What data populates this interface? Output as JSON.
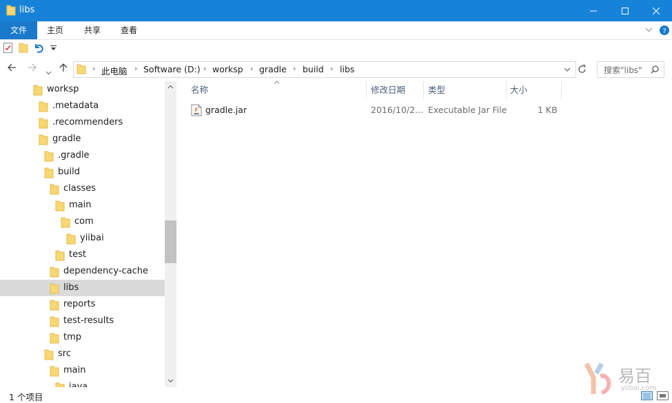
{
  "window": {
    "title": "libs"
  },
  "ribbon": {
    "tabs": [
      "文件",
      "主页",
      "共享",
      "查看"
    ]
  },
  "address": {
    "crumbs": [
      "此电脑",
      "Software (D:)",
      "worksp",
      "gradle",
      "build",
      "libs"
    ]
  },
  "search": {
    "placeholder": "搜索\"libs\""
  },
  "nav_tree": [
    {
      "label": "worksp",
      "level": 0
    },
    {
      "label": ".metadata",
      "level": 1
    },
    {
      "label": ".recommenders",
      "level": 1
    },
    {
      "label": "gradle",
      "level": 1
    },
    {
      "label": ".gradle",
      "level": 2
    },
    {
      "label": "build",
      "level": 2
    },
    {
      "label": "classes",
      "level": 3
    },
    {
      "label": "main",
      "level": 4
    },
    {
      "label": "com",
      "level": 5
    },
    {
      "label": "yiibai",
      "level": 6
    },
    {
      "label": "test",
      "level": 4
    },
    {
      "label": "dependency-cache",
      "level": 3
    },
    {
      "label": "libs",
      "level": 3,
      "selected": true
    },
    {
      "label": "reports",
      "level": 3
    },
    {
      "label": "test-results",
      "level": 3
    },
    {
      "label": "tmp",
      "level": 3
    },
    {
      "label": "src",
      "level": 2
    },
    {
      "label": "main",
      "level": 3
    },
    {
      "label": "java",
      "level": 4
    }
  ],
  "columns": {
    "name": "名称",
    "modified": "修改日期",
    "type": "类型",
    "size": "大小"
  },
  "files": [
    {
      "name": "gradle.jar",
      "modified": "2016/10/2...",
      "type": "Executable Jar File",
      "size": "1 KB",
      "icon": "java-jar-icon"
    }
  ],
  "status": {
    "count": "1 个项目"
  },
  "watermark": {
    "brand": "易百",
    "url": "yiibai.com"
  },
  "colors": {
    "titlebar": "#1783d8",
    "file_tab": "#1979ca",
    "folder": "#f8d775",
    "selected_row": "#dadada"
  }
}
